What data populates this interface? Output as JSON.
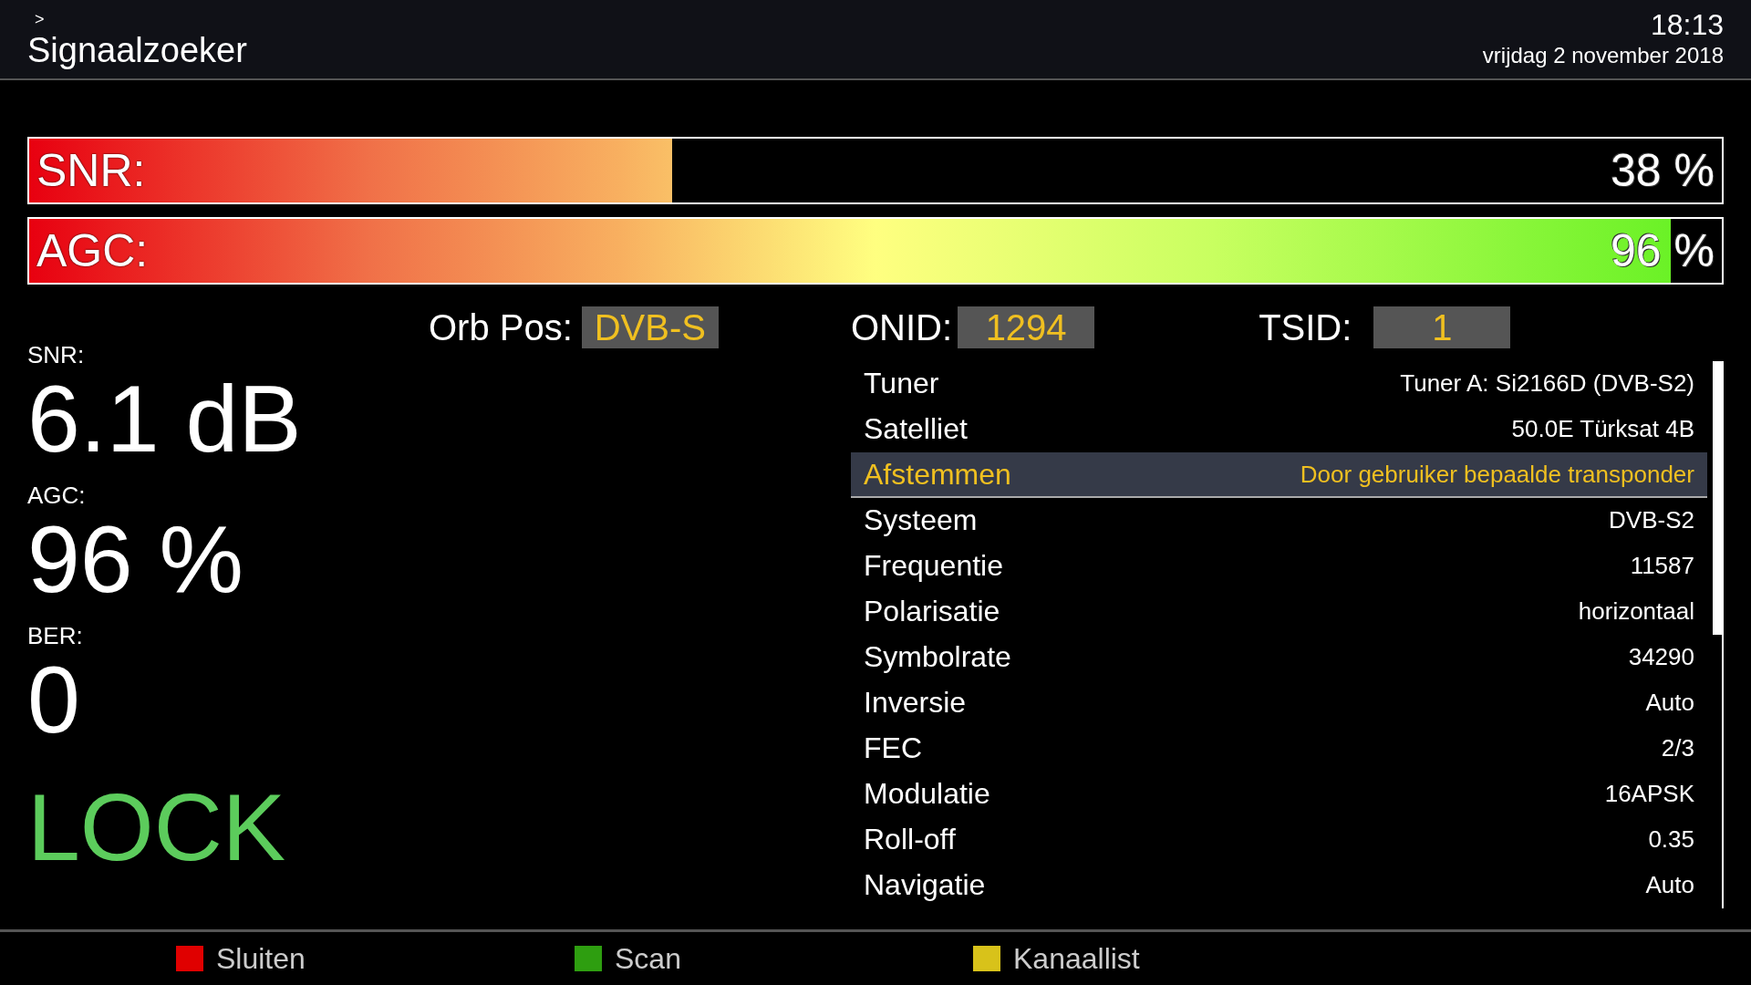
{
  "header": {
    "breadcrumb": ">",
    "title": "Signaalzoeker",
    "time": "18:13",
    "date": "vrijdag 2 november 2018"
  },
  "bars": [
    {
      "label": "SNR:",
      "level": 0.38,
      "reading": "38 %"
    },
    {
      "label": "AGC:",
      "level": 0.97,
      "reading": "96 %"
    }
  ],
  "readings": [
    {
      "label": "SNR:",
      "value": "6.1 dB"
    },
    {
      "label": "AGC:",
      "value": "96 %"
    },
    {
      "label": "BER:",
      "value": "0"
    }
  ],
  "lock_status": "LOCK",
  "info": [
    {
      "label": "Orb Pos:",
      "value": "DVB-S"
    },
    {
      "label": "ONID:",
      "value": "1294"
    },
    {
      "label": "TSID:",
      "value": "1"
    }
  ],
  "details": [
    {
      "label": "Tuner",
      "value": "Tuner A: Si2166D (DVB-S2)",
      "selected": false
    },
    {
      "label": "Satelliet",
      "value": "50.0E Türksat 4B",
      "selected": false
    },
    {
      "label": "Afstemmen",
      "value": "Door gebruiker bepaalde transponder",
      "selected": true
    },
    {
      "label": "Systeem",
      "value": "DVB-S2",
      "selected": false
    },
    {
      "label": "Frequentie",
      "value": "11587",
      "selected": false
    },
    {
      "label": "Polarisatie",
      "value": "horizontaal",
      "selected": false
    },
    {
      "label": "Symbolrate",
      "value": "34290",
      "selected": false
    },
    {
      "label": "Inversie",
      "value": "Auto",
      "selected": false
    },
    {
      "label": "FEC",
      "value": "2/3",
      "selected": false
    },
    {
      "label": "Modulatie",
      "value": "16APSK",
      "selected": false
    },
    {
      "label": "Roll-off",
      "value": "0.35",
      "selected": false
    },
    {
      "label": "Navigatie",
      "value": "Auto",
      "selected": false
    }
  ],
  "footer": [
    {
      "label": "Sluiten",
      "color": "#e00000"
    },
    {
      "label": "Scan",
      "color": "#2e9e10"
    },
    {
      "label": "Kanaallist",
      "color": "#d8c21a"
    }
  ]
}
